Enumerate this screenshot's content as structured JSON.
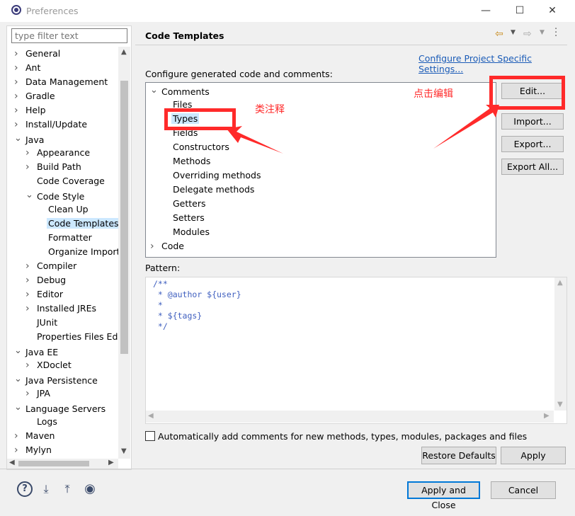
{
  "window": {
    "title": "Preferences",
    "controls": {
      "minimize": "—",
      "maximize": "☐",
      "close": "✕"
    }
  },
  "filter": {
    "placeholder": "type filter text"
  },
  "tree": [
    {
      "label": "General",
      "level": 0,
      "expander": "collapsed"
    },
    {
      "label": "Ant",
      "level": 0,
      "expander": "collapsed"
    },
    {
      "label": "Data Management",
      "level": 0,
      "expander": "collapsed"
    },
    {
      "label": "Gradle",
      "level": 0,
      "expander": "collapsed"
    },
    {
      "label": "Help",
      "level": 0,
      "expander": "collapsed"
    },
    {
      "label": "Install/Update",
      "level": 0,
      "expander": "collapsed"
    },
    {
      "label": "Java",
      "level": 0,
      "expander": "expanded"
    },
    {
      "label": "Appearance",
      "level": 1,
      "expander": "collapsed"
    },
    {
      "label": "Build Path",
      "level": 1,
      "expander": "collapsed"
    },
    {
      "label": "Code Coverage",
      "level": 1,
      "expander": "none"
    },
    {
      "label": "Code Style",
      "level": 1,
      "expander": "expanded"
    },
    {
      "label": "Clean Up",
      "level": 2,
      "expander": "none"
    },
    {
      "label": "Code Templates",
      "level": 2,
      "expander": "none",
      "selected": true
    },
    {
      "label": "Formatter",
      "level": 2,
      "expander": "none"
    },
    {
      "label": "Organize Imports",
      "level": 2,
      "expander": "none"
    },
    {
      "label": "Compiler",
      "level": 1,
      "expander": "collapsed"
    },
    {
      "label": "Debug",
      "level": 1,
      "expander": "collapsed"
    },
    {
      "label": "Editor",
      "level": 1,
      "expander": "collapsed"
    },
    {
      "label": "Installed JREs",
      "level": 1,
      "expander": "collapsed"
    },
    {
      "label": "JUnit",
      "level": 1,
      "expander": "none"
    },
    {
      "label": "Properties Files Editor",
      "level": 1,
      "expander": "none"
    },
    {
      "label": "Java EE",
      "level": 0,
      "expander": "expanded"
    },
    {
      "label": "XDoclet",
      "level": 1,
      "expander": "collapsed"
    },
    {
      "label": "Java Persistence",
      "level": 0,
      "expander": "expanded"
    },
    {
      "label": "JPA",
      "level": 1,
      "expander": "collapsed"
    },
    {
      "label": "Language Servers",
      "level": 0,
      "expander": "expanded"
    },
    {
      "label": "Logs",
      "level": 1,
      "expander": "none"
    },
    {
      "label": "Maven",
      "level": 0,
      "expander": "collapsed"
    },
    {
      "label": "Mylyn",
      "level": 0,
      "expander": "collapsed"
    }
  ],
  "page": {
    "title": "Code Templates",
    "project_link": "Configure Project Specific Settings...",
    "configure_label": "Configure generated code and comments:",
    "templates": [
      {
        "label": "Comments",
        "level": 0,
        "expander": "expanded"
      },
      {
        "label": "Files",
        "level": 1,
        "expander": "none"
      },
      {
        "label": "Types",
        "level": 1,
        "expander": "none",
        "selected": true
      },
      {
        "label": "Fields",
        "level": 1,
        "expander": "none"
      },
      {
        "label": "Constructors",
        "level": 1,
        "expander": "none"
      },
      {
        "label": "Methods",
        "level": 1,
        "expander": "none"
      },
      {
        "label": "Overriding methods",
        "level": 1,
        "expander": "none"
      },
      {
        "label": "Delegate methods",
        "level": 1,
        "expander": "none"
      },
      {
        "label": "Getters",
        "level": 1,
        "expander": "none"
      },
      {
        "label": "Setters",
        "level": 1,
        "expander": "none"
      },
      {
        "label": "Modules",
        "level": 1,
        "expander": "none"
      },
      {
        "label": "Code",
        "level": 0,
        "expander": "collapsed"
      }
    ],
    "buttons": {
      "edit": "Edit...",
      "import": "Import...",
      "export": "Export...",
      "export_all": "Export All..."
    },
    "pattern_label": "Pattern:",
    "pattern_lines": [
      "/**",
      " * @author ${user}",
      " *",
      " * ${tags}",
      " */"
    ],
    "auto_comment_label": "Automatically add comments for new methods, types, modules, packages and files",
    "auto_comment_checked": false,
    "restore_defaults": "Restore Defaults",
    "apply": "Apply"
  },
  "footer": {
    "apply_and_close": "Apply and Close",
    "cancel": "Cancel",
    "icons": [
      "help-icon",
      "import-prefs-icon",
      "export-prefs-icon",
      "oomph-icon"
    ]
  },
  "annotations": {
    "type_comment": "类注释",
    "click_edit": "点击编辑",
    "color": "#ff2a2a"
  }
}
